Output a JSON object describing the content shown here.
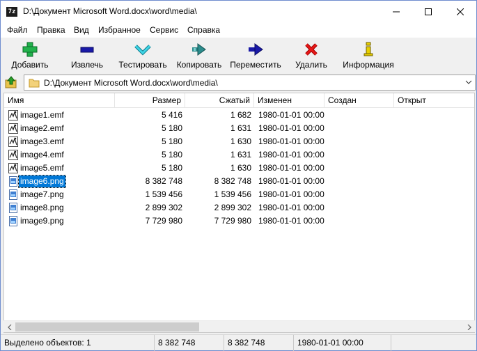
{
  "window": {
    "app_icon": "7z",
    "title": "D:\\Документ Microsoft Word.docx\\word\\media\\"
  },
  "menu": {
    "items": [
      "Файл",
      "Правка",
      "Вид",
      "Избранное",
      "Сервис",
      "Справка"
    ]
  },
  "toolbar": {
    "items": [
      {
        "label": "Добавить",
        "icon": "add-plus-icon",
        "color": "#22b14c"
      },
      {
        "label": "Извлечь",
        "icon": "extract-minus-icon",
        "color": "#1a1aa8"
      },
      {
        "label": "Тестировать",
        "icon": "test-check-icon",
        "color": "#22c3d8"
      },
      {
        "label": "Копировать",
        "icon": "copy-arrow-icon",
        "color": "#2c8c8c"
      },
      {
        "label": "Переместить",
        "icon": "move-arrow-icon",
        "color": "#1a1aa8"
      },
      {
        "label": "Удалить",
        "icon": "delete-x-icon",
        "color": "#e01010"
      },
      {
        "label": "Информация",
        "icon": "info-icon",
        "color": "#e8d000"
      }
    ]
  },
  "address": {
    "path": "D:\\Документ Microsoft Word.docx\\word\\media\\"
  },
  "list": {
    "columns": [
      "Имя",
      "Размер",
      "Сжатый",
      "Изменен",
      "Создан",
      "Открыт"
    ],
    "rows": [
      {
        "name": "image1.emf",
        "size": "5 416",
        "packed": "1 682",
        "modified": "1980-01-01 00:00",
        "type": "emf",
        "selected": false
      },
      {
        "name": "image2.emf",
        "size": "5 180",
        "packed": "1 631",
        "modified": "1980-01-01 00:00",
        "type": "emf",
        "selected": false
      },
      {
        "name": "image3.emf",
        "size": "5 180",
        "packed": "1 630",
        "modified": "1980-01-01 00:00",
        "type": "emf",
        "selected": false
      },
      {
        "name": "image4.emf",
        "size": "5 180",
        "packed": "1 631",
        "modified": "1980-01-01 00:00",
        "type": "emf",
        "selected": false
      },
      {
        "name": "image5.emf",
        "size": "5 180",
        "packed": "1 630",
        "modified": "1980-01-01 00:00",
        "type": "emf",
        "selected": false
      },
      {
        "name": "image6.png",
        "size": "8 382 748",
        "packed": "8 382 748",
        "modified": "1980-01-01 00:00",
        "type": "png",
        "selected": true
      },
      {
        "name": "image7.png",
        "size": "1 539 456",
        "packed": "1 539 456",
        "modified": "1980-01-01 00:00",
        "type": "png",
        "selected": false
      },
      {
        "name": "image8.png",
        "size": "2 899 302",
        "packed": "2 899 302",
        "modified": "1980-01-01 00:00",
        "type": "png",
        "selected": false
      },
      {
        "name": "image9.png",
        "size": "7 729 980",
        "packed": "7 729 980",
        "modified": "1980-01-01 00:00",
        "type": "png",
        "selected": false
      }
    ]
  },
  "status": {
    "selected": "Выделено объектов: 1",
    "size": "8 382 748",
    "packed": "8 382 748",
    "modified": "1980-01-01 00:00"
  },
  "colors": {
    "selection": "#0078d7"
  }
}
